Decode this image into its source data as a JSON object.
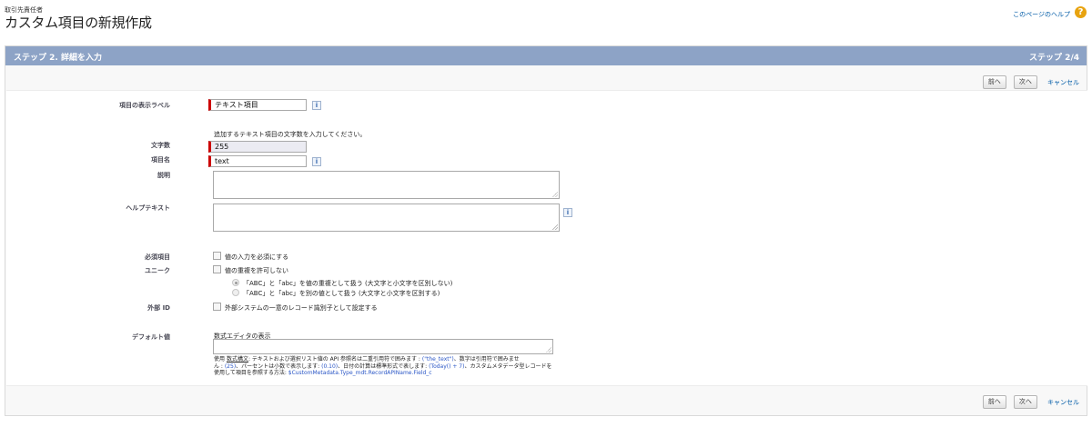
{
  "header": {
    "object_label": "取引先責任者",
    "page_title": "カスタム項目の新規作成",
    "help_link": "このページのヘルプ",
    "help_icon_glyph": "?"
  },
  "step_bar": {
    "title": "ステップ 2. 詳細を入力",
    "count": "ステップ 2/4"
  },
  "buttons": {
    "prev": "前へ",
    "next": "次へ",
    "cancel": "キャンセル"
  },
  "form": {
    "field_label": {
      "label": "項目の表示ラベル",
      "value": "テキスト項目"
    },
    "length_instruction": "追加するテキスト項目の文字数を入力してください。",
    "length": {
      "label": "文字数",
      "value": "255"
    },
    "field_name": {
      "label": "項目名",
      "value": "text"
    },
    "description": {
      "label": "説明",
      "value": ""
    },
    "help_text": {
      "label": "ヘルプテキスト",
      "value": ""
    },
    "required": {
      "label": "必須項目",
      "option": "値の入力を必須にする",
      "checked": false
    },
    "unique": {
      "label": "ユニーク",
      "option": "値の重複を許可しない",
      "checked": false,
      "radio_options": [
        {
          "text": "「ABC」と「abc」を値の重複として扱う (大文字と小文字を区別しない)",
          "selected": true
        },
        {
          "text": "「ABC」と「abc」を別の値として扱う (大文字と小文字を区別する)",
          "selected": false
        }
      ]
    },
    "external_id": {
      "label": "外部 ID",
      "option": "外部システムの一意のレコード識別子として設定する",
      "checked": false
    },
    "default_value": {
      "label": "デフォルト値",
      "formula_link": "数式エディタの表示",
      "value": "",
      "hint_line1_a": "使用",
      "hint_line1_b": "数式構文",
      "hint_line1_c": ": テキストおよび選択リスト値の API 参照名は二重引用符で囲みます : ",
      "hint_ex1": "(\"the_text\")",
      "hint_line1_d": "、数字は引用符で囲みませ",
      "hint_line2_a": "ん : ",
      "hint_ex2": "(25)",
      "hint_line2_b": "、パーセントは小数で表示します: ",
      "hint_ex3": "(0.10)",
      "hint_line2_c": "、日付の計算は標準形式で表します: ",
      "hint_ex4": "(Today() + 7)",
      "hint_line2_d": "、カスタムメタデータ型レコードを",
      "hint_line3_a": "使用して項目を参照する方法: ",
      "hint_ex5": "$CustomMetadata.Type_mdt.RecordAPIName.Field_c"
    }
  },
  "colors": {
    "step_bar": "#8da3c6",
    "required_marker": "#cc0000",
    "link": "#015ba7",
    "help_icon": "#e8a30f"
  }
}
